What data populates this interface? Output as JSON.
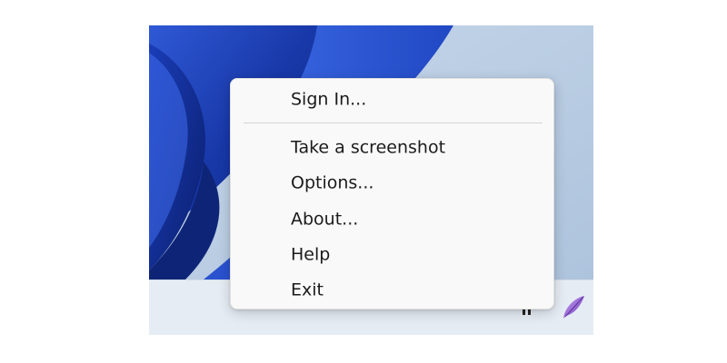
{
  "context_menu": {
    "sign_in": "Sign In...",
    "take_screenshot": "Take a screenshot",
    "options": "Options...",
    "about": "About...",
    "help": "Help",
    "exit": "Exit"
  },
  "tray": {
    "app_icon": "feather-quill-icon",
    "accent_color": "#8f5fd0"
  },
  "wallpaper": {
    "style": "windows-11-bloom",
    "primary_color": "#1a3fb0",
    "background_color": "#b9cde3"
  }
}
